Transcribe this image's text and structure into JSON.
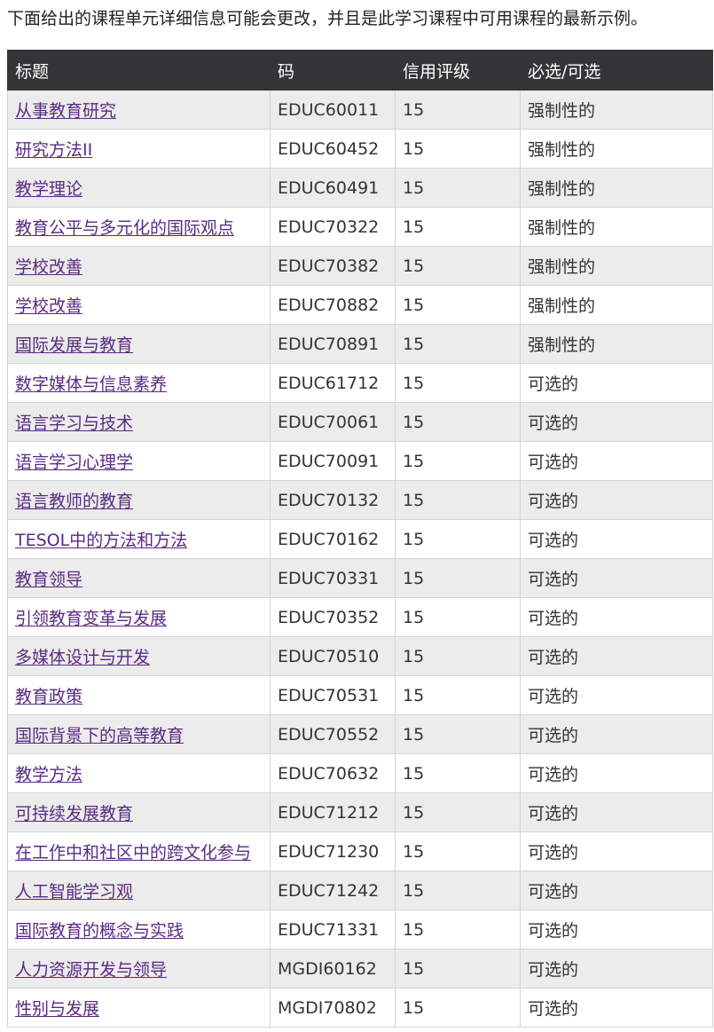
{
  "intro": "下面给出的课程单元详细信息可能会更改，并且是此学习课程中可用课程的最新示例。",
  "table": {
    "headers": {
      "title": "标题",
      "code": "码",
      "credits": "信用评级",
      "type": "必选/可选"
    },
    "rows": [
      {
        "title": "从事教育研究",
        "code": "EDUC60011",
        "credits": "15",
        "type": "强制性的"
      },
      {
        "title": "研究方法II",
        "code": "EDUC60452",
        "credits": "15",
        "type": "强制性的"
      },
      {
        "title": "教学理论",
        "code": "EDUC60491",
        "credits": "15",
        "type": "强制性的"
      },
      {
        "title": "教育公平与多元化的国际观点",
        "code": "EDUC70322",
        "credits": "15",
        "type": "强制性的"
      },
      {
        "title": "学校改善",
        "code": "EDUC70382",
        "credits": "15",
        "type": "强制性的"
      },
      {
        "title": "学校改善",
        "code": "EDUC70882",
        "credits": "15",
        "type": "强制性的"
      },
      {
        "title": "国际发展与教育",
        "code": "EDUC70891",
        "credits": "15",
        "type": "强制性的"
      },
      {
        "title": "数字媒体与信息素养",
        "code": "EDUC61712",
        "credits": "15",
        "type": "可选的"
      },
      {
        "title": "语言学习与技术",
        "code": "EDUC70061",
        "credits": "15",
        "type": "可选的"
      },
      {
        "title": "语言学习心理学",
        "code": "EDUC70091",
        "credits": "15",
        "type": "可选的"
      },
      {
        "title": "语言教师的教育",
        "code": "EDUC70132",
        "credits": "15",
        "type": "可选的"
      },
      {
        "title": "TESOL中的方法和方法",
        "code": "EDUC70162",
        "credits": "15",
        "type": "可选的"
      },
      {
        "title": "教育领导",
        "code": "EDUC70331",
        "credits": "15",
        "type": "可选的"
      },
      {
        "title": "引领教育变革与发展",
        "code": "EDUC70352",
        "credits": "15",
        "type": "可选的"
      },
      {
        "title": "多媒体设计与开发",
        "code": "EDUC70510",
        "credits": "15",
        "type": "可选的"
      },
      {
        "title": "教育政策",
        "code": "EDUC70531",
        "credits": "15",
        "type": "可选的"
      },
      {
        "title": "国际背景下的高等教育",
        "code": "EDUC70552",
        "credits": "15",
        "type": "可选的"
      },
      {
        "title": "教学方法",
        "code": "EDUC70632",
        "credits": "15",
        "type": "可选的"
      },
      {
        "title": "可持续发展教育",
        "code": "EDUC71212",
        "credits": "15",
        "type": "可选的"
      },
      {
        "title": "在工作中和社区中的跨文化参与",
        "code": "EDUC71230",
        "credits": "15",
        "type": "可选的"
      },
      {
        "title": "人工智能学习观",
        "code": "EDUC71242",
        "credits": "15",
        "type": "可选的"
      },
      {
        "title": "国际教育的概念与实践",
        "code": "EDUC71331",
        "credits": "15",
        "type": "可选的"
      },
      {
        "title": "人力资源开发与领导",
        "code": "MGDI60162",
        "credits": "15",
        "type": "可选的"
      },
      {
        "title": "性别与发展",
        "code": "MGDI70802",
        "credits": "15",
        "type": "可选的"
      }
    ]
  },
  "colors": {
    "header_bg": "#333537",
    "link": "#5a2a82",
    "row_alt": "#ececec"
  }
}
